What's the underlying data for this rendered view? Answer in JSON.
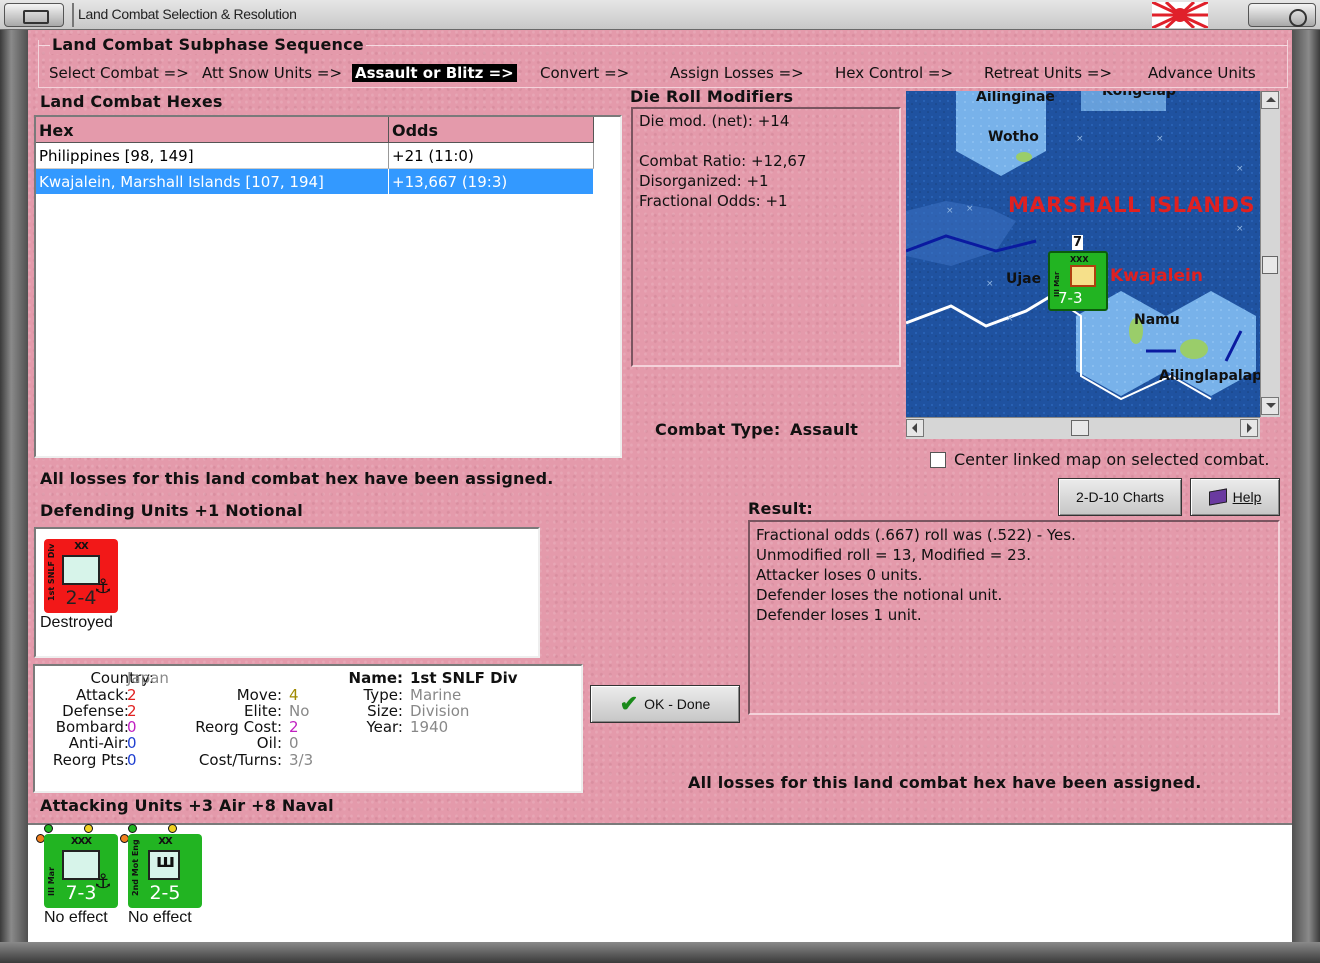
{
  "window": {
    "title": "Land Combat Selection & Resolution"
  },
  "subphase": {
    "title": "Land Combat Subphase Sequence",
    "steps": [
      "Select Combat =>",
      "Att Snow Units =>",
      "Assault or Blitz =>",
      "Convert =>",
      "Assign Losses =>",
      "Hex Control =>",
      "Retreat Units =>",
      "Advance Units"
    ],
    "active_index": 2
  },
  "hexes": {
    "title": "Land Combat Hexes",
    "columns": [
      "Hex",
      "Odds"
    ],
    "rows": [
      {
        "hex": "Philippines [98, 149]",
        "odds": "+21 (11:0)"
      },
      {
        "hex": "Kwajalein, Marshall Islands [107, 194]",
        "odds": "+13,667 (19:3)"
      }
    ],
    "selected_index": 1
  },
  "die_roll": {
    "title": "Die Roll Modifiers",
    "lines": [
      "Die mod. (net): +14",
      "Combat Ratio: +12,67",
      "Disorganized: +1",
      "Fractional Odds: +1"
    ]
  },
  "combat_type": {
    "label": "Combat Type:",
    "value": "Assault"
  },
  "map": {
    "labels": {
      "ailinginae": "Ailinginae",
      "kongelap": "Kongelap",
      "wotho": "Wotho",
      "region": "MARSHALL ISLANDS",
      "ujae": "Ujae",
      "kwajalein": "Kwajalein",
      "namu": "Namu",
      "ailinglapalap": "Ailinglapalap"
    },
    "stack_count": "7",
    "unit_strength": "7-3",
    "unit_size": "XXX",
    "unit_name": "III Mar"
  },
  "center_linked": {
    "label": "Center linked map on selected combat.",
    "checked": false
  },
  "buttons": {
    "charts": "2-D-10 Charts",
    "help": "Help",
    "ok": "OK - Done"
  },
  "losses_msg_top": "All losses for this land combat hex have been assigned.",
  "losses_msg_bottom": "All losses for this land combat hex have been assigned.",
  "result": {
    "title": "Result:",
    "lines": [
      "Fractional odds (.667) roll was (.522)  - Yes.",
      "Unmodified roll = 13, Modified = 23.",
      "Attacker loses 0 units.",
      "Defender loses the notional unit.",
      "Defender loses 1 unit."
    ]
  },
  "defending": {
    "title": "Defending Units +1 Notional",
    "units": [
      {
        "name": "1st SNLF Div",
        "size": "XX",
        "strength": "2-4",
        "status": "Destroyed",
        "color": "#f21818"
      }
    ]
  },
  "unit_info": {
    "country_k": "Country:",
    "country_v": "Japan",
    "attack_k": "Attack:",
    "attack_v": "2",
    "defense_k": "Defense:",
    "defense_v": "2",
    "bombard_k": "Bombard:",
    "bombard_v": "0",
    "antiair_k": "Anti-Air:",
    "antiair_v": "0",
    "reorgpts_k": "Reorg Pts:",
    "reorgpts_v": "0",
    "move_k": "Move:",
    "move_v": "4",
    "elite_k": "Elite:",
    "elite_v": "No",
    "reorgcost_k": "Reorg Cost:",
    "reorgcost_v": "2",
    "oil_k": "Oil:",
    "oil_v": "0",
    "costturns_k": "Cost/Turns:",
    "costturns_v": "3/3",
    "name_k": "Name:",
    "name_v": "1st SNLF Div",
    "type_k": "Type:",
    "type_v": "Marine",
    "size_k": "Size:",
    "size_v": "Division",
    "year_k": "Year:",
    "year_v": "1940"
  },
  "attacking": {
    "title": "Attacking Units +3 Air +8 Naval",
    "units": [
      {
        "name": "III Mar",
        "size": "XXX",
        "strength": "7-3",
        "status": "No effect",
        "color": "#22b422"
      },
      {
        "name": "2nd Mot Eng",
        "size": "XX",
        "strength": "2-5",
        "status": "No effect",
        "color": "#22b422"
      }
    ]
  }
}
